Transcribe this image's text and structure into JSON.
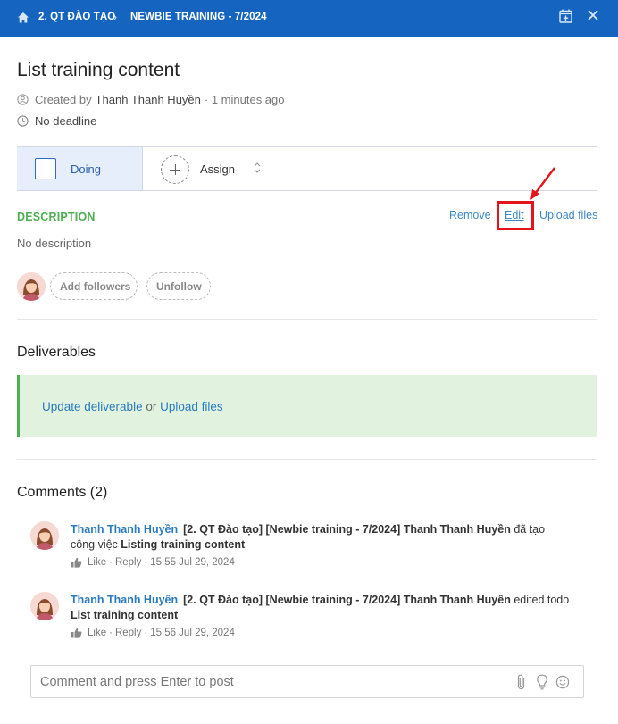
{
  "header": {
    "breadcrumb_1": "2. QT ĐÀO TẠO",
    "breadcrumb_sep": "›",
    "breadcrumb_2": "NEWBIE TRAINING - 7/2024",
    "bg_color": "#1565c0"
  },
  "task": {
    "title": "List training content",
    "created_prefix": "Created by",
    "author": "Thanh Thanh Huyền",
    "created_suffix": "· 1 minutes ago",
    "deadline": "No deadline",
    "status": "Doing",
    "assign_label": "Assign"
  },
  "description": {
    "title": "DESCRIPTION",
    "remove_label": "Remove",
    "edit_label": "Edit",
    "upload_label": "Upload files",
    "text": "No description"
  },
  "followers": {
    "add_label": "Add followers",
    "unfollow_label": "Unfollow"
  },
  "deliverables": {
    "title": "Deliverables",
    "update_label": "Update deliverable",
    "or_text": " or ",
    "upload_label": "Upload files"
  },
  "comments": {
    "title": "Comments (2)",
    "items": [
      {
        "author": "Thanh Thanh Huyền",
        "text_prefix": "[2. QT Đào tạo] [Newbie training - 7/2024] Thanh Thanh Huyền",
        "text_mid": " đã tạo công việc ",
        "text_bold": "Listing training content",
        "like": "Like",
        "reply": "Reply",
        "time": "15:55 Jul 29, 2024"
      },
      {
        "author": "Thanh Thanh Huyền",
        "text_prefix": "[2. QT Đào tạo] [Newbie training - 7/2024] Thanh Thanh Huyền",
        "text_mid": " edited todo ",
        "text_bold": "List training content",
        "like": "Like",
        "reply": "Reply",
        "time": "15:56 Jul 29, 2024"
      }
    ],
    "input_placeholder": "Comment and press Enter to post"
  },
  "colors": {
    "accent_blue": "#1565c0",
    "link_blue": "#2b7bbf",
    "description_green": "#4caf50",
    "deliverable_bg": "#e1f3df",
    "highlight_red": "#e3141b"
  }
}
